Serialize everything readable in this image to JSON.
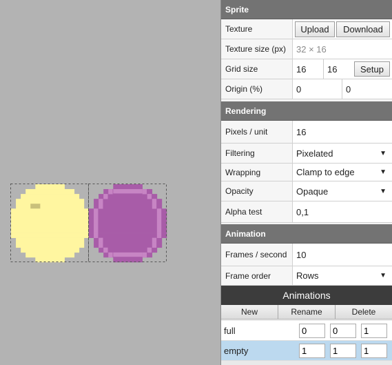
{
  "sprite": {
    "header": "Sprite",
    "texture_label": "Texture",
    "upload_label": "Upload",
    "download_label": "Download",
    "texture_size_label": "Texture size (px)",
    "texture_size_value": "32 × 16",
    "grid_size_label": "Grid size",
    "grid_w": "16",
    "grid_h": "16",
    "setup_label": "Setup",
    "origin_label": "Origin (%)",
    "origin_x": "0",
    "origin_y": "0"
  },
  "rendering": {
    "header": "Rendering",
    "ppu_label": "Pixels / unit",
    "ppu_value": "16",
    "filtering_label": "Filtering",
    "filtering_value": "Pixelated",
    "wrapping_label": "Wrapping",
    "wrapping_value": "Clamp to edge",
    "opacity_label": "Opacity",
    "opacity_value": "Opaque",
    "alpha_label": "Alpha test",
    "alpha_value": "0,1"
  },
  "animation": {
    "header": "Animation",
    "fps_label": "Frames / second",
    "fps_value": "10",
    "order_label": "Frame order",
    "order_value": "Rows"
  },
  "animations": {
    "title": "Animations",
    "new_label": "New",
    "rename_label": "Rename",
    "delete_label": "Delete",
    "items": [
      {
        "name": "full",
        "a": "0",
        "b": "0",
        "c": "1",
        "selected": false
      },
      {
        "name": "empty",
        "a": "1",
        "b": "1",
        "c": "1",
        "selected": true
      }
    ]
  },
  "colors": {
    "full_fill": "#fff6a0",
    "empty_fill": "#a85ca8",
    "empty_ring": "#c785c4",
    "background": "#b3b3b3"
  }
}
